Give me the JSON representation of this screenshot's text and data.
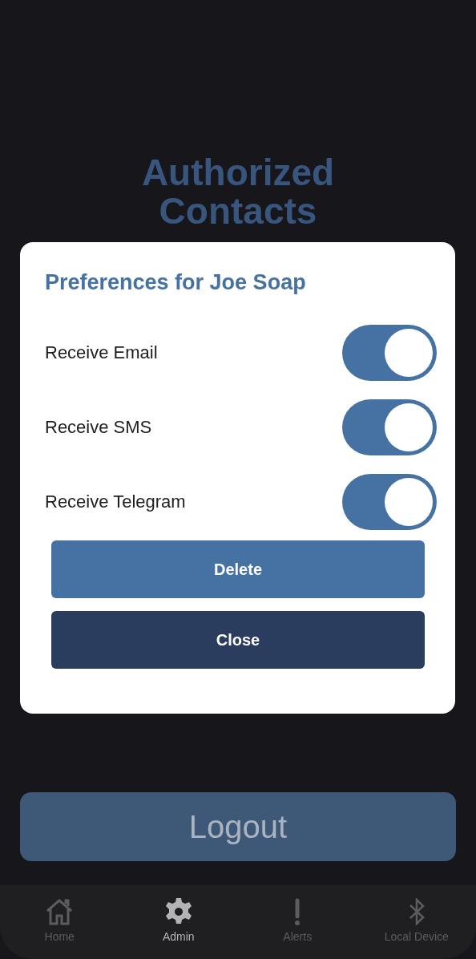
{
  "page": {
    "title": "Authorized Contacts"
  },
  "dialog": {
    "title": "Preferences for Joe Soap",
    "toggles": [
      {
        "label": "Receive Email",
        "on": true
      },
      {
        "label": "Receive SMS",
        "on": true
      },
      {
        "label": "Receive Telegram",
        "on": true
      }
    ],
    "buttons": [
      {
        "label": "Delete",
        "kind": "primary"
      },
      {
        "label": "Close",
        "kind": "dark"
      }
    ]
  },
  "logout_button": {
    "label": "Logout"
  },
  "tab_bar": [
    {
      "label": "Home",
      "kind": "home",
      "selected": false
    },
    {
      "label": "Admin",
      "kind": "gear",
      "selected": true
    },
    {
      "label": "Alerts",
      "kind": "alert",
      "selected": false
    },
    {
      "label": "Local Device",
      "kind": "bluetooth",
      "selected": false
    }
  ]
}
